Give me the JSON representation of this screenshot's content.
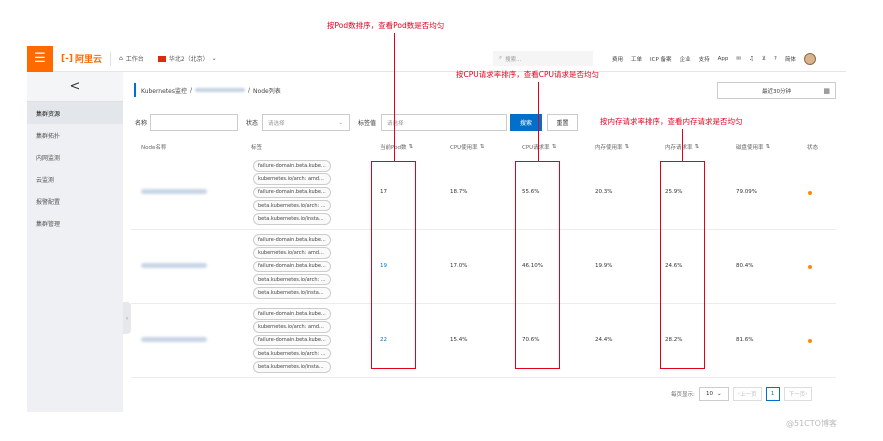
{
  "topbar": {
    "menu_icon": "hamburger-icon",
    "logo_text": "阿里云",
    "workbench": "工作台",
    "region": "华北2（北京）",
    "search_placeholder": "搜索...",
    "nav": [
      "费用",
      "工单",
      "ICP 备案",
      "企业",
      "支持",
      "App"
    ],
    "lang": "简体"
  },
  "sidebar": {
    "back": "<",
    "items": [
      "集群资源",
      "集群拓扑",
      "内网监测",
      "云监测",
      "报警配置",
      "集群管理"
    ]
  },
  "breadcrumb": {
    "root": "Kubernetes监控",
    "current": "Node列表",
    "separator": "/"
  },
  "time_range": "最近30分钟",
  "filters": {
    "name_label": "名称",
    "status_label": "状态",
    "status_placeholder": "请选择",
    "tag_label": "标签值",
    "tag_placeholder": "请选择",
    "search_button": "搜索",
    "reset_button": "重置"
  },
  "table": {
    "headers": [
      "Node名称",
      "标签",
      "当前Pod数",
      "CPU使用率",
      "CPU请求率",
      "内存使用率",
      "内存请求率",
      "磁盘使用率",
      "状态"
    ],
    "rows": [
      {
        "pods": "17",
        "cpu_use": "18.7%",
        "cpu_req": "55.6%",
        "mem_use": "20.3%",
        "mem_req": "25.9%",
        "disk": "79.09%",
        "tags": [
          "failure-domain.beta.kube...",
          "kubernetes.io/arch: amd...",
          "failure-domain.beta.kube...",
          "beta.kubernetes.io/arch: ...",
          "beta.kubernetes.io/insta..."
        ]
      },
      {
        "pods": "19",
        "cpu_use": "17.0%",
        "cpu_req": "46.10%",
        "mem_use": "19.9%",
        "mem_req": "24.6%",
        "disk": "80.4%",
        "tags": [
          "failure-domain.beta.kube...",
          "kubernetes.io/arch: amd...",
          "failure-domain.beta.kube...",
          "beta.kubernetes.io/arch: ...",
          "beta.kubernetes.io/insta..."
        ]
      },
      {
        "pods": "22",
        "cpu_use": "15.4%",
        "cpu_req": "70.6%",
        "mem_use": "24.4%",
        "mem_req": "28.2%",
        "disk": "81.6%",
        "tags": [
          "failure-domain.beta.kube...",
          "kubernetes.io/arch: amd...",
          "failure-domain.beta.kube...",
          "beta.kubernetes.io/arch: ...",
          "beta.kubernetes.io/insta..."
        ]
      }
    ]
  },
  "pagination": {
    "page_size_label": "每页显示:",
    "page_size": "10",
    "prev": "上一页",
    "current": "1",
    "next": "下一页"
  },
  "annotations": {
    "pods": "按Pod数排序，查看Pod数是否均匀",
    "cpu": "按CPU请求率排序，查看CPU请求是否均匀",
    "mem": "按内存请求率排序，查看内存请求是否均匀"
  },
  "watermark": "@51CTO博客",
  "colors": {
    "accent": "#ff6a00",
    "primary": "#0070cc",
    "annotation": "#e0001e",
    "status_dot": "#ff8a00"
  }
}
